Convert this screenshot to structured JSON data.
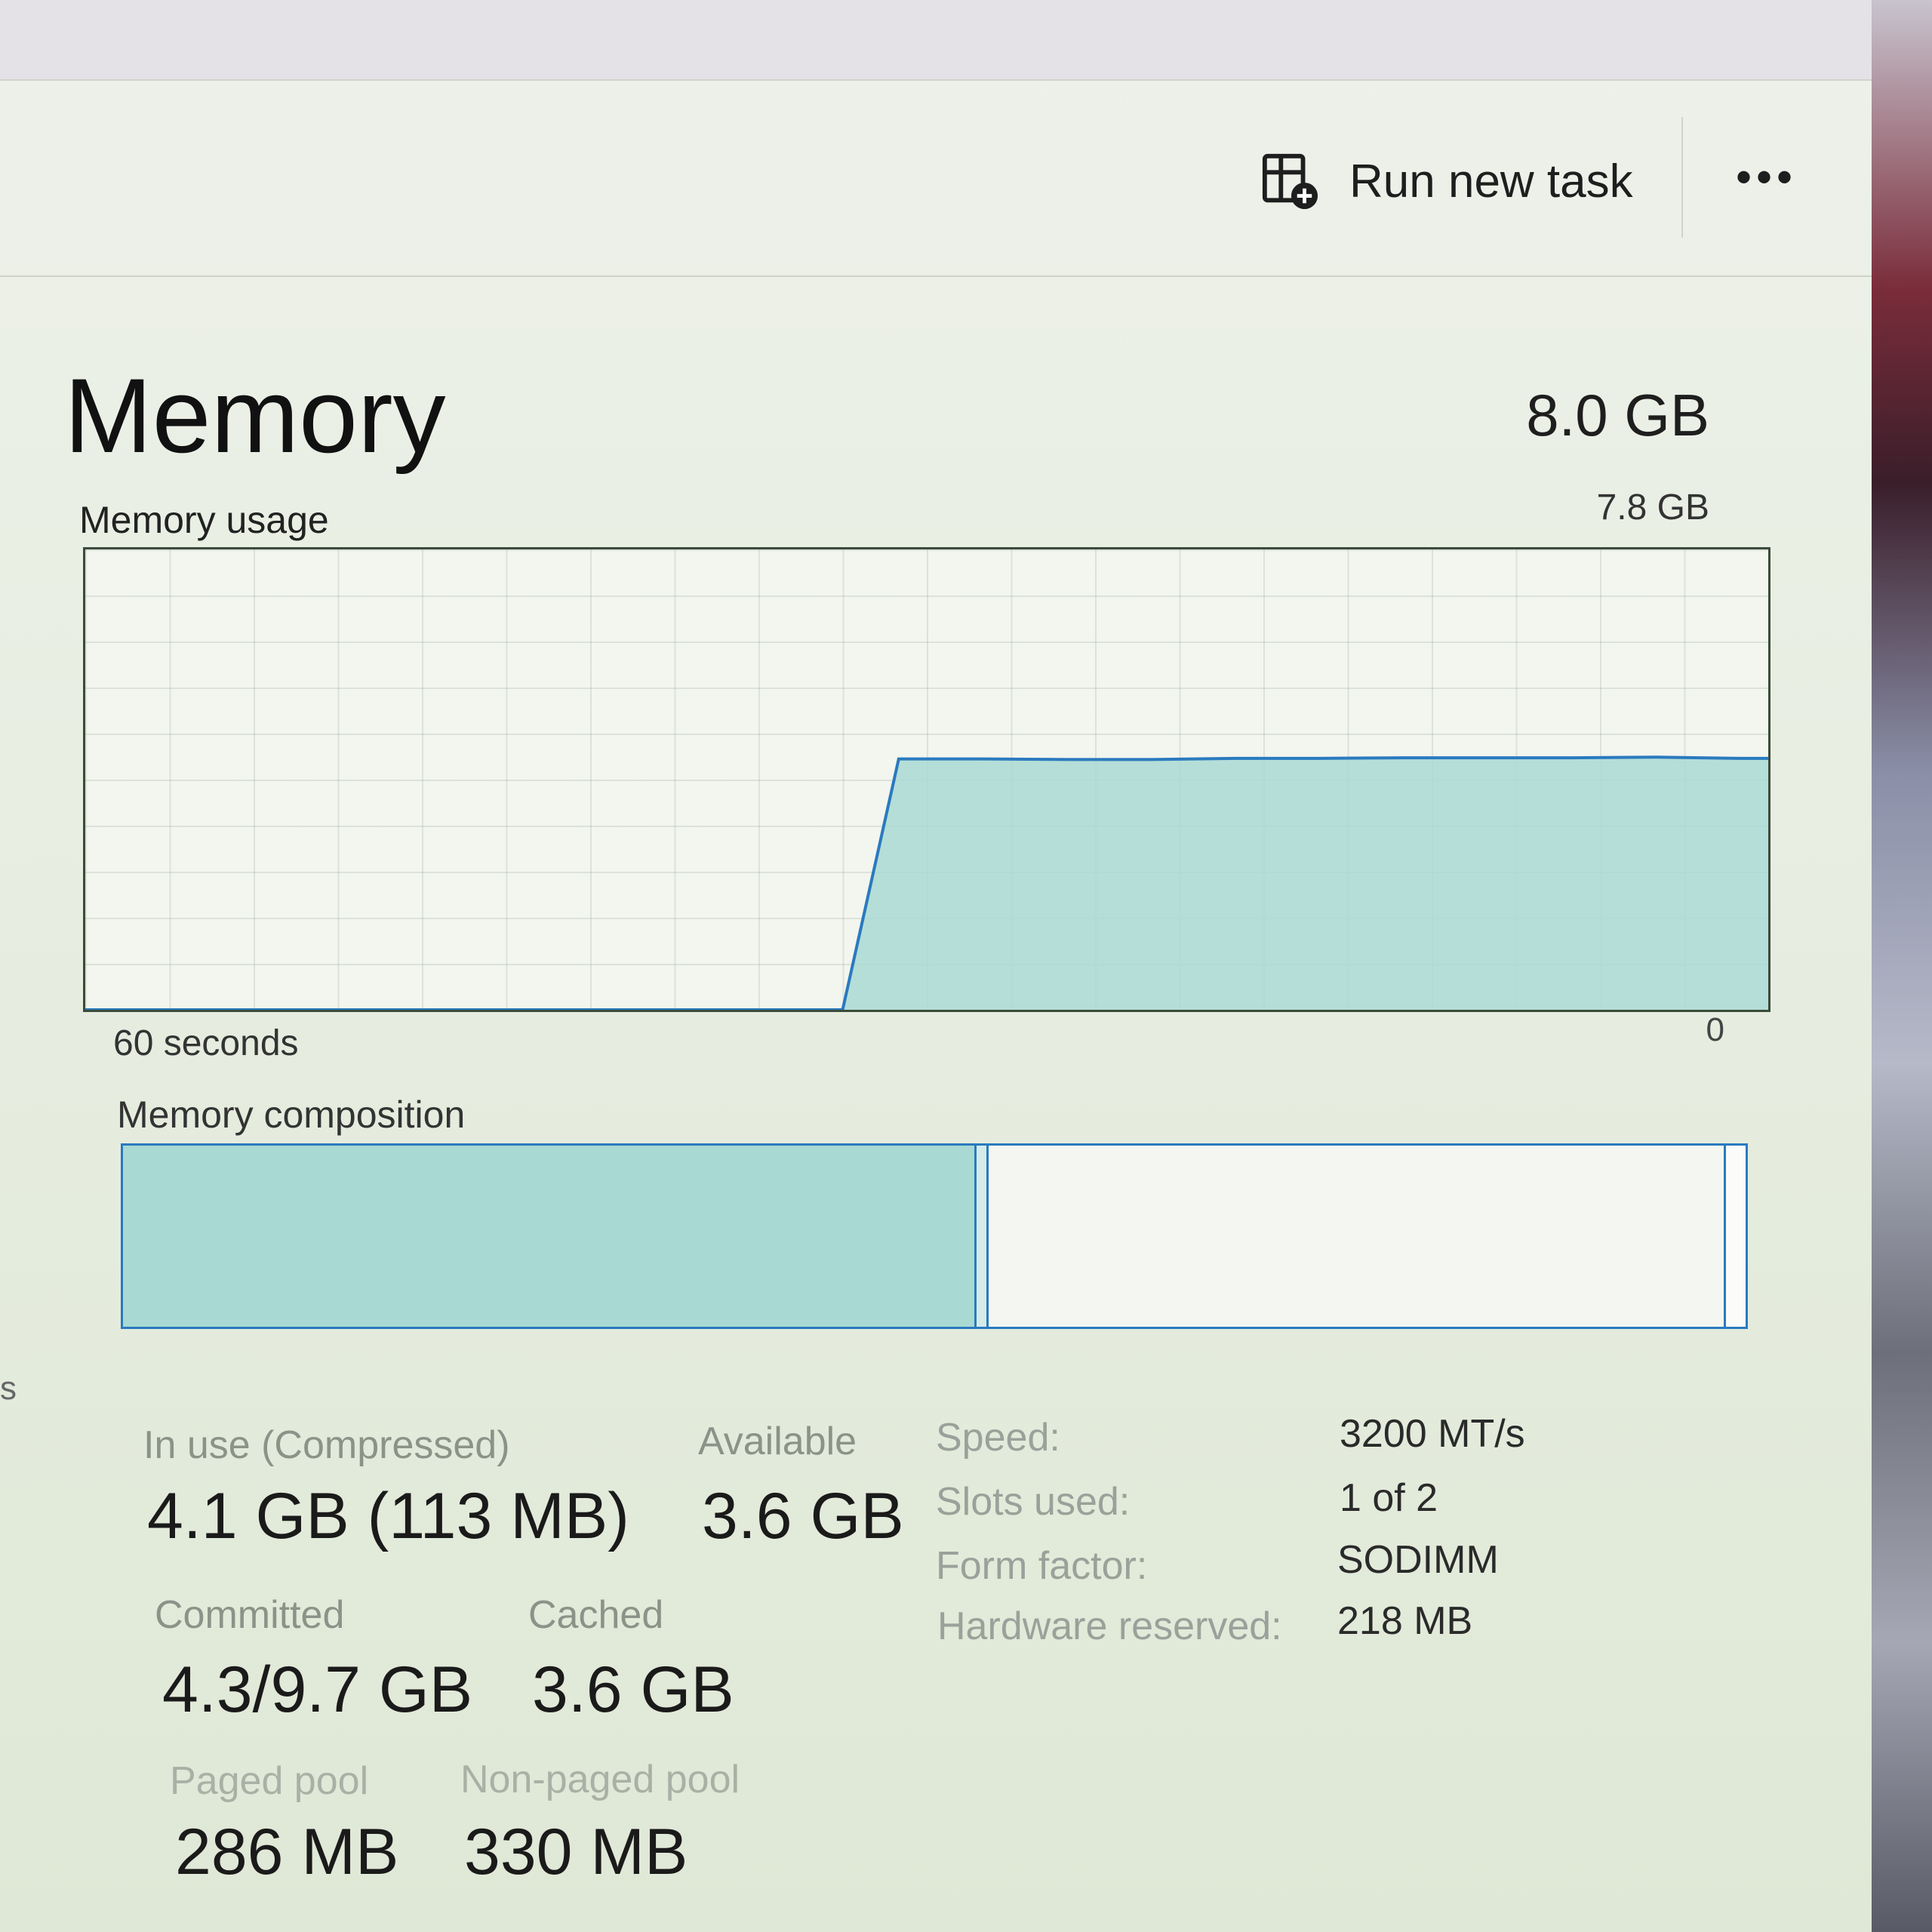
{
  "toolbar": {
    "run_task_label": "Run new task",
    "more_label": "•••"
  },
  "page": {
    "title": "Memory",
    "total": "8.0 GB"
  },
  "usage_graph": {
    "label": "Memory usage",
    "max_label": "7.8 GB",
    "x_left_label": "60 seconds",
    "x_right_label": "0",
    "accent": "#2a7abf",
    "fill": "#a9d9d3"
  },
  "chart_data": {
    "type": "area",
    "title": "Memory usage",
    "x": [
      60,
      33,
      31,
      28,
      25,
      22,
      19,
      16,
      13,
      10,
      7,
      4,
      1,
      0
    ],
    "values": [
      0,
      0,
      4.25,
      4.25,
      4.24,
      4.24,
      4.26,
      4.26,
      4.27,
      4.27,
      4.27,
      4.28,
      4.26,
      4.26
    ],
    "xlabel": "60 seconds",
    "ylabel": "",
    "ylim": [
      0,
      7.8
    ],
    "xlim": [
      60,
      0
    ],
    "grid": true
  },
  "composition": {
    "label": "Memory composition",
    "in_use_fraction": 0.527,
    "modified_fraction": 0.006,
    "standby_fraction": 0.455,
    "free_fraction": 0.012
  },
  "stats": {
    "in_use_label": "In use (Compressed)",
    "in_use_value": "4.1 GB (113 MB)",
    "available_label": "Available",
    "available_value": "3.6 GB",
    "committed_label": "Committed",
    "committed_value": "4.3/9.7 GB",
    "cached_label": "Cached",
    "cached_value": "3.6 GB",
    "paged_label": "Paged pool",
    "paged_value": "286 MB",
    "nonpaged_label": "Non-paged pool",
    "nonpaged_value": "330 MB"
  },
  "specs": {
    "speed_label": "Speed:",
    "speed_value": "3200 MT/s",
    "slots_label": "Slots used:",
    "slots_value": "1 of 2",
    "form_label": "Form factor:",
    "form_value": "SODIMM",
    "hw_label": "Hardware reserved:",
    "hw_value": "218 MB"
  },
  "edge_glyph": "s"
}
